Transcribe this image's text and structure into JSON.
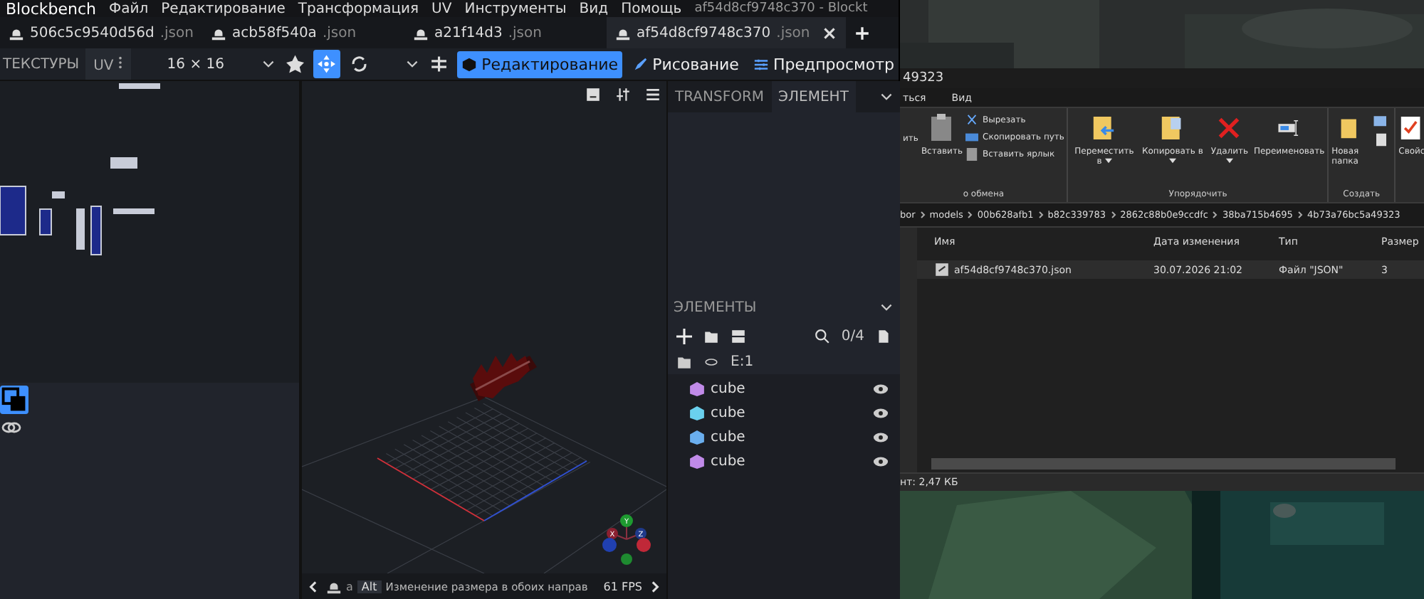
{
  "window": {
    "app_name": "Blockbench",
    "menus": [
      "Файл",
      "Редактирование",
      "Трансформация",
      "UV",
      "Инструменты",
      "Вид",
      "Помощь"
    ],
    "title": "af54d8cf9748c370 - Blockt"
  },
  "tabs": [
    {
      "name": "506c5c9540d56d",
      "ext": ".json",
      "selected": false
    },
    {
      "name": "acb58f540a",
      "ext": ".json",
      "selected": false
    },
    {
      "name": "a21f14d3",
      "ext": ".json",
      "selected": false
    },
    {
      "name": "af54d8cf9748c370",
      "ext": ".json",
      "selected": true
    }
  ],
  "toolbar": {
    "textures_label": "ТЕКСТУРЫ",
    "uv_tab": "UV",
    "resolution": "16 × 16",
    "modes": [
      {
        "label": "Редактирование",
        "selected": true
      },
      {
        "label": "Рисование",
        "selected": false
      },
      {
        "label": "Предпросмотр",
        "selected": false
      }
    ]
  },
  "properties": {
    "tabs": [
      {
        "label": "TRANSFORM",
        "selected": false
      },
      {
        "label": "ЭЛЕМЕНТ",
        "selected": true
      }
    ]
  },
  "outliner": {
    "title": "ЭЛЕМЕНТЫ",
    "counter": "0/4",
    "path": "E:1",
    "items": [
      {
        "name": "cube",
        "color": "#c08ae8"
      },
      {
        "name": "cube",
        "color": "#6ad0ee"
      },
      {
        "name": "cube",
        "color": "#6aaeee"
      },
      {
        "name": "cube",
        "color": "#c08ae8"
      }
    ]
  },
  "gizmo": {
    "y": "Y",
    "x": "X",
    "z": "Z"
  },
  "status_bar": {
    "prefix": "a",
    "key": "Alt",
    "hint": "Изменение размера в обоих направ",
    "fps": "61 FPS"
  },
  "explorer": {
    "title": "49323",
    "menus": [
      "ться",
      "Вид"
    ],
    "clipboard": {
      "partial": "ить",
      "paste": "Вставить",
      "cut": "Вырезать",
      "copy_path": "Скопировать путь",
      "paste_shortcut": "Вставить ярлык",
      "group": "о обмена"
    },
    "organize": {
      "move": "Переместить в",
      "copy": "Копировать в",
      "delete": "Удалить",
      "rename": "Переименовать",
      "group": "Упорядочить"
    },
    "create": {
      "new_folder": "Новая папка",
      "group": "Создать"
    },
    "properties": "Свойс",
    "breadcrumb": [
      "bor",
      "models",
      "00b628afb1",
      "b82c339783",
      "2862c88b0e9ccdfc",
      "38ba715b4695",
      "4b73a76bc5a49323"
    ],
    "columns": [
      "Имя",
      "Дата изменения",
      "Тип",
      "Размер"
    ],
    "rows": [
      {
        "name": "af54d8cf9748c370.json",
        "date": "30.07.2026 21:02",
        "type": "Файл \"JSON\"",
        "size": "3",
        "selected": true
      }
    ],
    "status": "нт: 2,47 КБ"
  }
}
